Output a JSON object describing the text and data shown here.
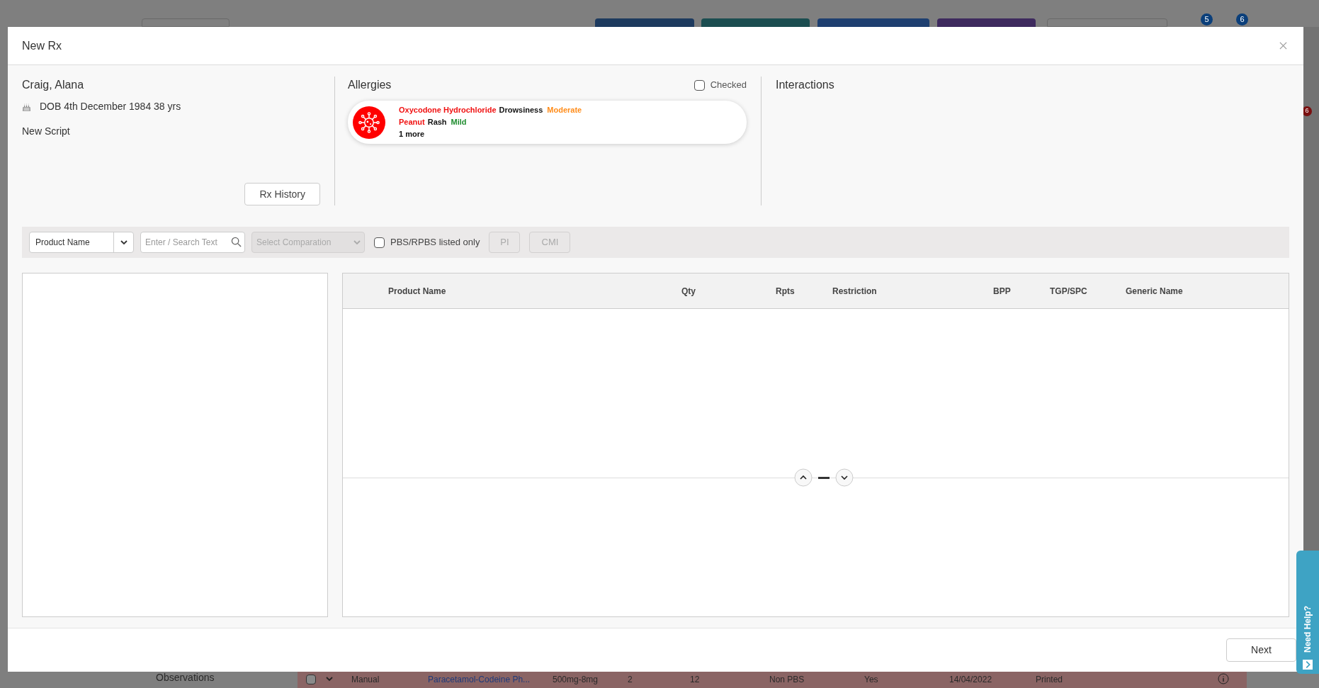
{
  "background": {
    "top_badges": [
      "5",
      "6"
    ],
    "side_badge": "6",
    "section": "Observations",
    "row": {
      "checked": false,
      "cells": [
        "Manual",
        "Paracetamol-Codeine Ph...",
        "500mg-8mg",
        "2",
        "12",
        "Non PBS",
        "Yes",
        "14/04/2022",
        "Printed"
      ]
    }
  },
  "dialog": {
    "title": "New Rx",
    "patient": {
      "name": "Craig, Alana",
      "dob": "DOB 4th December 1984 38 yrs",
      "script": "New Script"
    },
    "history_button": "Rx History",
    "allergies": {
      "title": "Allergies",
      "checked_label": "Checked",
      "checked": false,
      "items": [
        {
          "substance": "Oxycodone Hydrochloride",
          "reaction": "Drowsiness",
          "severity": "Moderate",
          "color": "#ff8c1a"
        },
        {
          "substance": "Peanut",
          "reaction": "Rash",
          "severity": "Mild",
          "color": "#1e8c2e"
        }
      ],
      "more": "1 more"
    },
    "interactions": {
      "title": "Interactions"
    },
    "search": {
      "field": "Product Name",
      "placeholder": "Enter / Search Text",
      "comparison_placeholder": "Select Comparation",
      "pbs_label": "PBS/RPBS listed only",
      "pbs_checked": false,
      "buttons": [
        "PI",
        "CMI"
      ]
    },
    "table": {
      "columns": [
        "Product Name",
        "Qty",
        "Rpts",
        "Restriction",
        "BPP",
        "TGP/SPC",
        "Generic Name"
      ]
    },
    "next_button": "Next"
  },
  "help_tab": "Need Help?"
}
